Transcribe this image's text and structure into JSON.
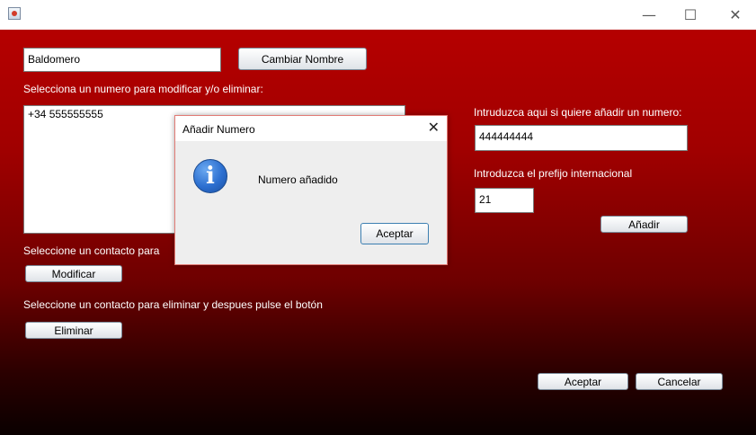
{
  "window": {
    "minimize_glyph": "—",
    "maximize_glyph": "☐",
    "close_glyph": "✕"
  },
  "form": {
    "name_value": "Baldomero",
    "change_name_button": "Cambiar Nombre",
    "select_number_label": "Selecciona un numero para modificar y/o eliminar:",
    "numbers": [
      "+34 555555555"
    ],
    "add_number_label": "Intruduzca aqui si quiere añadir un numero:",
    "add_number_value": "444444444",
    "prefix_label": "Introduzca el prefijo internacional",
    "prefix_value": "21",
    "add_button": "Añadir",
    "modify_label": "Seleccione un contacto para",
    "modify_button": "Modificar",
    "delete_label": "Seleccione un contacto para eliminar y despues pulse el botón",
    "delete_button": "Eliminar",
    "accept_button": "Aceptar",
    "cancel_button": "Cancelar"
  },
  "dialog": {
    "title": "Añadir Numero",
    "close_glyph": "✕",
    "icon": "info-icon",
    "icon_glyph": "i",
    "message": "Numero añadido",
    "accept_button": "Aceptar"
  },
  "colors": {
    "background_top": "#b50000",
    "background_bottom": "#0a0000",
    "dialog_border": "#e27b75"
  }
}
